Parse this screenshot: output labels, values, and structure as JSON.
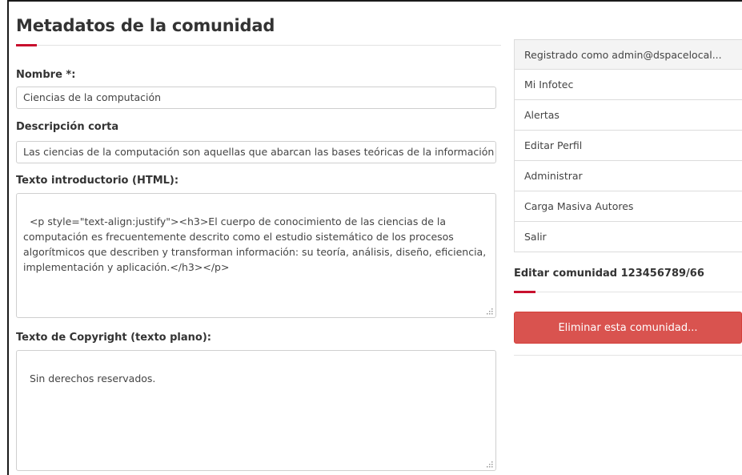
{
  "form": {
    "title": "Metadatos de la comunidad",
    "name": {
      "label": "Nombre *:",
      "value": "Ciencias de la computación"
    },
    "short_description": {
      "label": "Descripción corta",
      "value": "Las ciencias de la computación son aquellas que abarcan las bases teóricas de la información"
    },
    "intro_text": {
      "label": "Texto introductorio (HTML):",
      "value": "<p style=\"text-align:justify\"><h3>El cuerpo de conocimiento de las ciencias de la computación es frecuentemente descrito como el estudio sistemático de los procesos algorítmicos que describen y transforman información: su teoría, análisis, diseño, eficiencia, implementación y aplicación.</h3></p>"
    },
    "copyright": {
      "label": "Texto de Copyright (texto plano):",
      "value": "Sin derechos reservados."
    }
  },
  "sidebar": {
    "items": [
      {
        "label": "Registrado como admin@dspacelocal..."
      },
      {
        "label": "Mi Infotec"
      },
      {
        "label": "Alertas"
      },
      {
        "label": "Editar Perfil"
      },
      {
        "label": "Administrar"
      },
      {
        "label": "Carga Masiva Autores"
      },
      {
        "label": "Salir"
      }
    ],
    "edit_section": {
      "title": "Editar comunidad 123456789/66",
      "delete_button": "Eliminar esta comunidad..."
    }
  },
  "colors": {
    "accent": "#c8102e",
    "danger": "#d9534f",
    "border": "#cfcfcf"
  },
  "icons": {
    "textarea_resize": "resize-grip-icon"
  }
}
